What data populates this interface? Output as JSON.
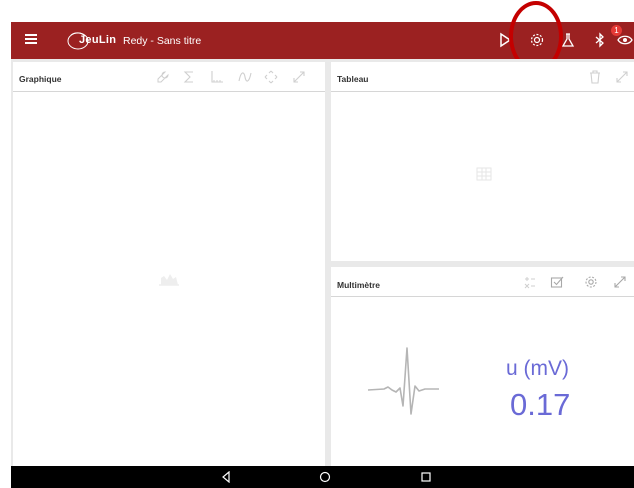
{
  "topbar": {
    "brand": "JeuLin",
    "title": "Redy - Sans titre",
    "bluetooth_badge": "1",
    "color": "#9b2121"
  },
  "panels": {
    "graph": {
      "title": "Graphique"
    },
    "table": {
      "title": "Tableau"
    },
    "multimeter": {
      "title": "Multimètre",
      "label": "u (mV)",
      "value": "0.17",
      "value_color": "#6a6ad6"
    }
  },
  "icons": {
    "topbar": [
      "menu-icon",
      "play-icon",
      "settings-icon",
      "flask-icon",
      "bluetooth-icon",
      "eye-icon"
    ],
    "graph_tools": [
      "wrench-icon",
      "sum-icon",
      "axes-icon",
      "curve-icon",
      "move-icon",
      "expand-icon"
    ],
    "table_tools": [
      "trash-icon",
      "expand-icon"
    ],
    "meter_tools": [
      "settings-precision-icon",
      "checkbox-icon",
      "settings-icon",
      "expand-icon"
    ],
    "android_nav": [
      "back-icon",
      "home-icon",
      "recents-icon"
    ]
  }
}
